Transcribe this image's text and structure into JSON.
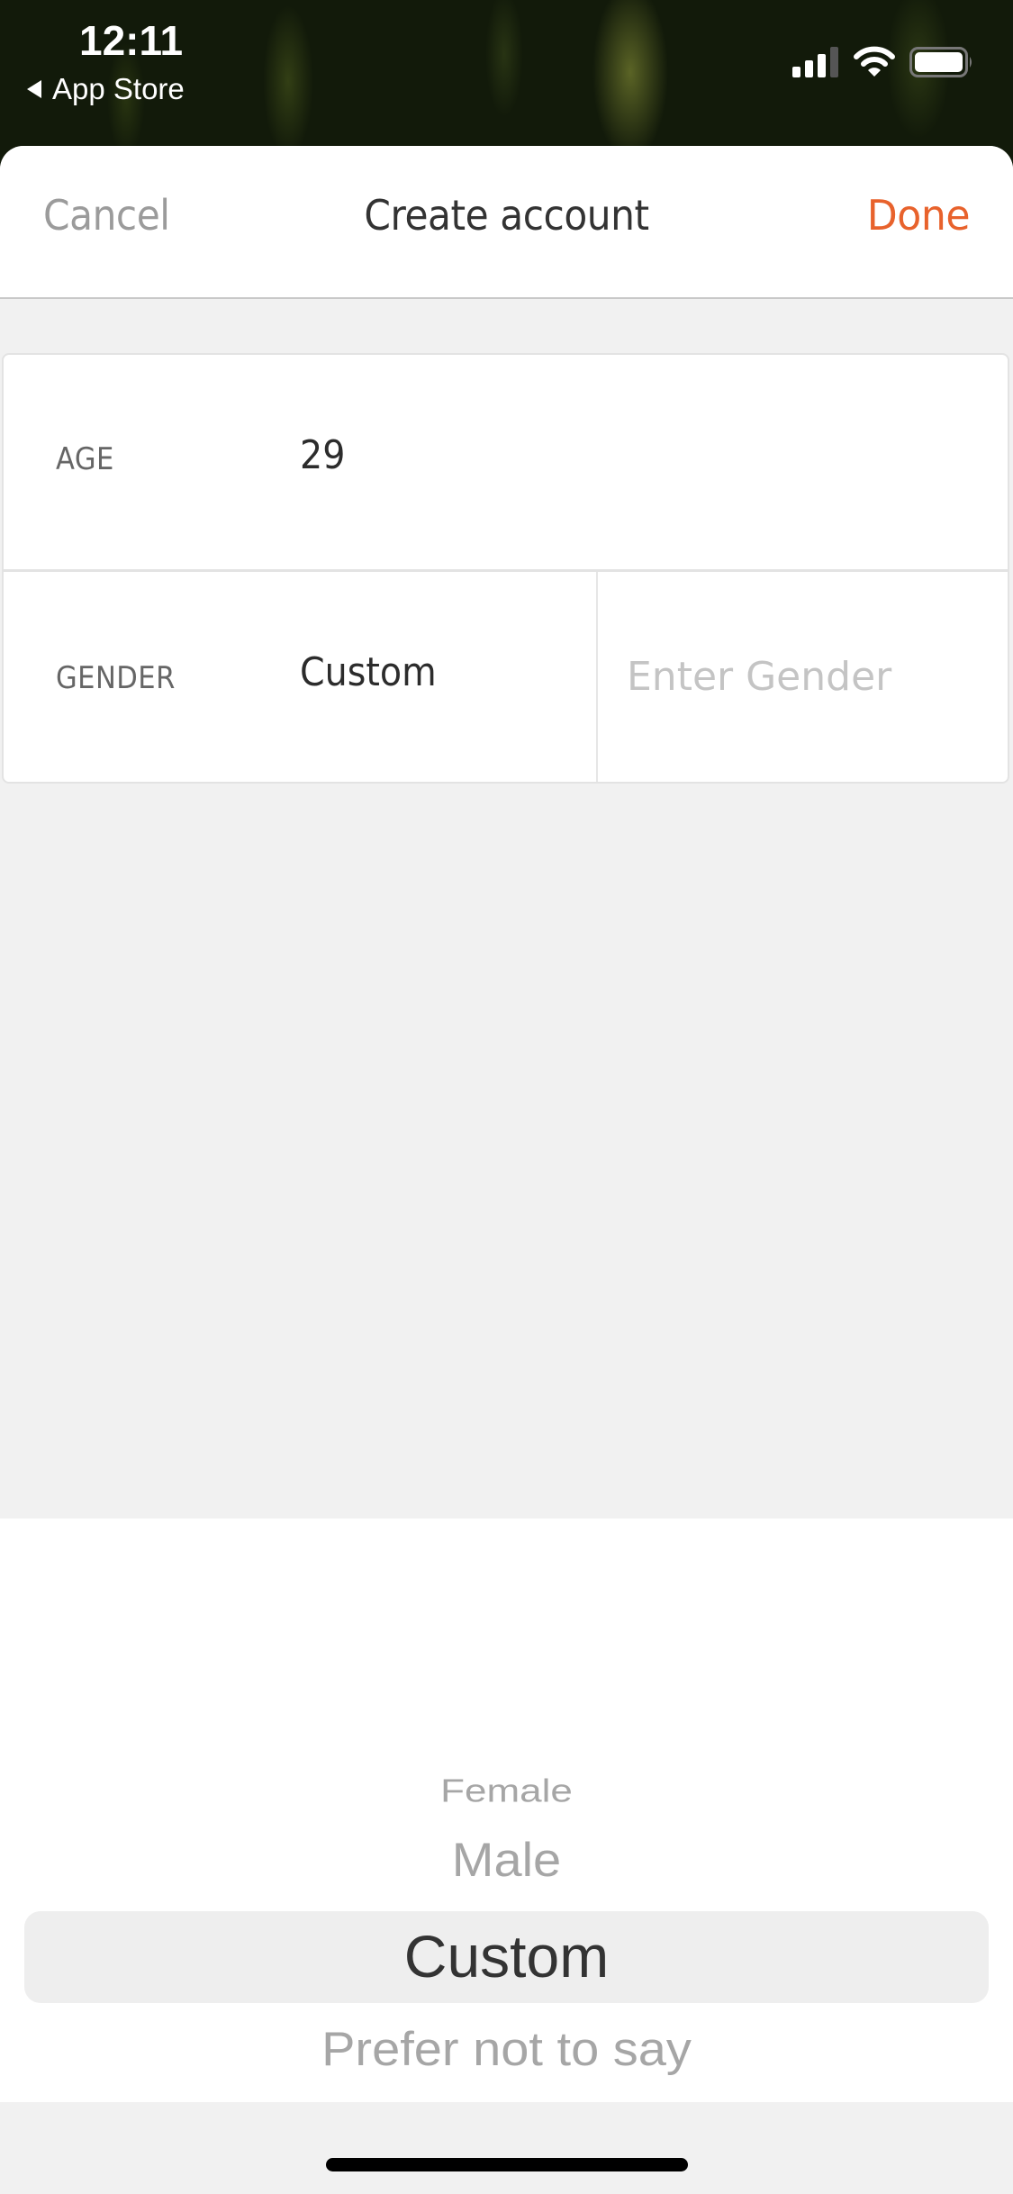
{
  "status_bar": {
    "time": "12:11",
    "back_app_label": "App Store",
    "icons": [
      "signal-icon",
      "wifi-icon",
      "battery-icon"
    ]
  },
  "navbar": {
    "cancel_label": "Cancel",
    "title": "Create account",
    "done_label": "Done",
    "accent_color": "#e8622c"
  },
  "form": {
    "age": {
      "label": "AGE",
      "value": "29"
    },
    "gender": {
      "label": "GENDER",
      "value": "Custom",
      "custom_input": {
        "value": "",
        "placeholder": "Enter Gender"
      }
    }
  },
  "picker": {
    "options": [
      "Female",
      "Male",
      "Custom",
      "Prefer not to say"
    ],
    "selected": "Custom"
  }
}
